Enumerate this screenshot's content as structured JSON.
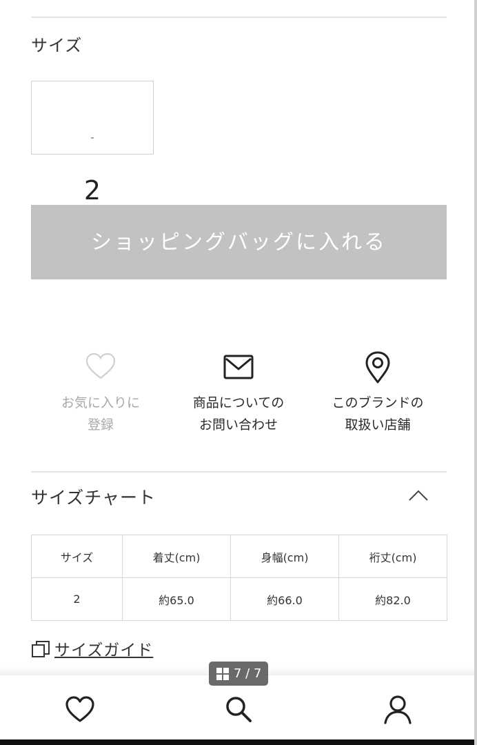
{
  "size_section": {
    "label": "サイズ",
    "options": [
      {
        "size": "2",
        "stock": "-"
      }
    ]
  },
  "cart_button": {
    "label": "ショッピングバッグに入れる",
    "bg_color": "#c2c2c2"
  },
  "actions": [
    {
      "icon": "heart-icon",
      "line1": "お気に入りに",
      "line2": "登録",
      "disabled": true
    },
    {
      "icon": "envelope-icon",
      "line1": "商品についての",
      "line2": "お問い合わせ",
      "disabled": false
    },
    {
      "icon": "map-pin-icon",
      "line1": "このブランドの",
      "line2": "取扱い店舗",
      "disabled": false
    }
  ],
  "size_chart": {
    "title": "サイズチャート",
    "toggle_icon": "chevron-up-icon",
    "headers": [
      "サイズ",
      "着丈(cm)",
      "身幅(cm)",
      "裄丈(cm)"
    ],
    "rows": [
      [
        "2",
        "約65.0",
        "約66.0",
        "約82.0"
      ]
    ]
  },
  "size_guide": {
    "icon": "copy-icon",
    "label": "サイズガイド"
  },
  "image_counter": {
    "icon": "grid-icon",
    "text": "7 / 7"
  },
  "bottom_nav": [
    {
      "icon": "heart-icon",
      "name": "favorites"
    },
    {
      "icon": "search-icon",
      "name": "search"
    },
    {
      "icon": "user-icon",
      "name": "account"
    }
  ]
}
